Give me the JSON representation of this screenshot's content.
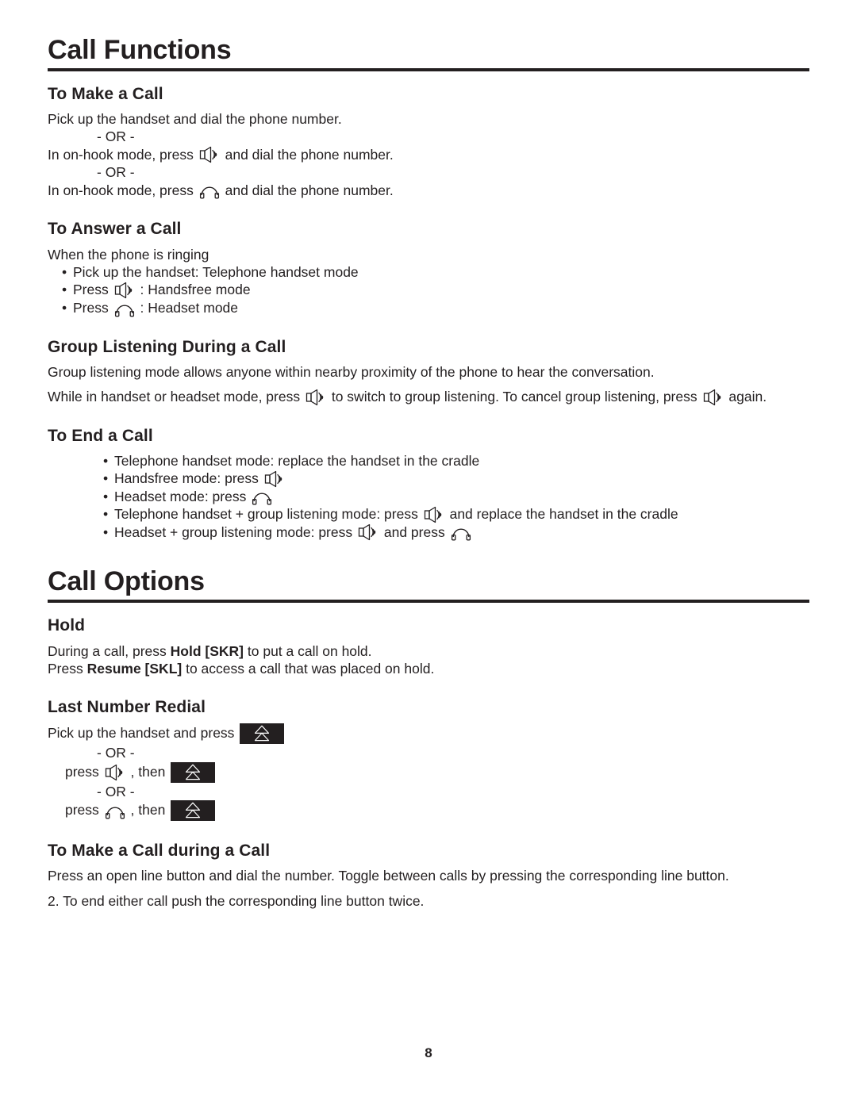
{
  "document": {
    "page_number": "8",
    "ink_color": "#231f20",
    "redial_key_bg": "#231f20"
  },
  "icons": {
    "speaker": "speaker-icon",
    "headset": "headset-icon",
    "redial": "redial-double-up-arrow-icon"
  },
  "sections": [
    {
      "id": "call-functions",
      "title": "Call Functions"
    },
    {
      "id": "call-options",
      "title": "Call Options"
    }
  ],
  "call_functions": {
    "title": "Call Functions",
    "to_make_a_call": {
      "heading": "To Make a Call",
      "line1": "Pick up the handset and dial the phone number.",
      "or1": "- OR -",
      "line2_before": "In on-hook mode, press",
      "line2_after": "and dial the phone number.",
      "or2": "- OR -",
      "line3_before": "In on-hook mode, press",
      "line3_after": "and dial the phone number."
    },
    "to_answer_a_call": {
      "heading": "To Answer a Call",
      "intro": "When the phone is ringing",
      "bullet1": "Pick up the handset: Telephone handset mode",
      "bullet2_before": "Press",
      "bullet2_after": ": Handsfree mode",
      "bullet3_before": "Press",
      "bullet3_after": ": Headset mode"
    },
    "group_listening": {
      "heading": "Group Listening During a Call",
      "line1": "Group listening mode allows anyone within nearby proximity of the phone to hear the conversation.",
      "line2_part1": "While in handset or headset mode, press",
      "line2_part2": "to switch to group listening. To cancel group listening, press",
      "line2_part3": "again."
    },
    "to_end_a_call": {
      "heading": "To End a Call",
      "bullet1": "Telephone handset mode: replace the handset in the cradle",
      "bullet2_before": "Handsfree mode: press",
      "bullet3_before": "Headset mode: press",
      "bullet4_before": "Telephone handset + group listening mode:  press",
      "bullet4_after": "and replace the handset in the cradle",
      "bullet5_before": "Headset + group listening mode: press",
      "bullet5_mid": "and press"
    }
  },
  "call_options": {
    "title": "Call Options",
    "hold": {
      "heading": "Hold",
      "line1_part1": "During a call, press ",
      "line1_bold": "Hold [SKR]",
      "line1_part2": " to put a call on hold.",
      "line2_part1": "Press ",
      "line2_bold": "Resume [SKL]",
      "line2_part2": " to access a call that was placed on hold."
    },
    "last_number_redial": {
      "heading": "Last Number Redial",
      "line1_before": "Pick up the handset and press",
      "or1": "- OR -",
      "line2_before": "press",
      "line2_mid": ", then",
      "or2": "- OR -",
      "line3_before": "press",
      "line3_mid": ", then"
    },
    "call_during_call": {
      "heading": "To Make a Call during a Call",
      "line1": "Press an open line button and dial the number. Toggle between calls by pressing the corresponding line button.",
      "line2": "2. To end either call push the corresponding line button twice."
    }
  }
}
